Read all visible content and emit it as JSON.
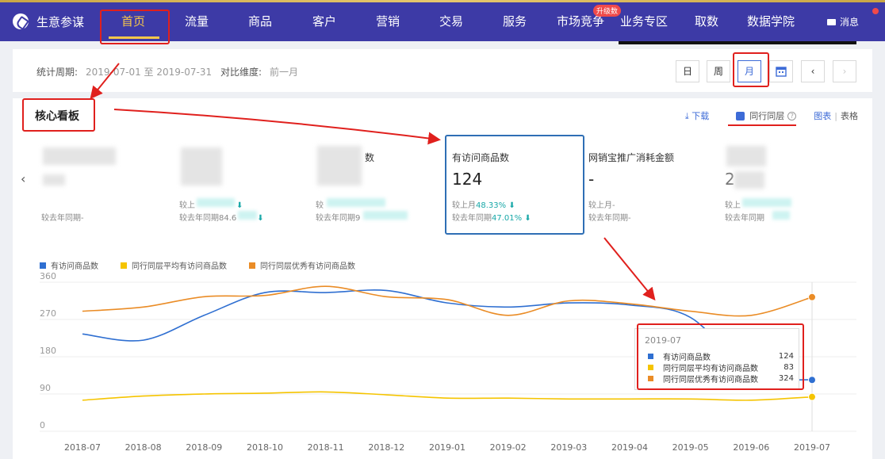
{
  "nav": {
    "brand": "生意参谋",
    "items": [
      "首页",
      "流量",
      "商品",
      "客户",
      "营销",
      "交易",
      "服务",
      "市场竞争",
      "业务专区",
      "取数",
      "数据学院"
    ],
    "active_index": 0,
    "badge": "升级数",
    "message": "消息"
  },
  "period": {
    "range_label": "统计周期:",
    "range_value": "2019-07-01 至 2019-07-31",
    "compare_label": "对比维度:",
    "compare_value": "前一月",
    "buttons": [
      "日",
      "周",
      "月"
    ],
    "active": "月",
    "calendar_icon": "calendar-icon",
    "prev_icon": "chevron-left-icon",
    "next_icon": "chevron-right-icon"
  },
  "board": {
    "title": "核心看板",
    "download": "下载",
    "peer_toggle": "同行同层",
    "peer_checked": true,
    "view_chart": "图表",
    "view_table": "表格"
  },
  "kpis": [
    {
      "name": "",
      "value": "",
      "mom": "",
      "yoy": "较去年同期-"
    },
    {
      "name": "",
      "value": "",
      "mom": "较上",
      "yoy": "较去年同期84.6"
    },
    {
      "name": "数",
      "value": "",
      "mom": "较",
      "yoy": "较去年同期9"
    },
    {
      "name": "有访问商品数",
      "value": "124",
      "mom": "较上月",
      "mom_pct": "48.33%",
      "yoy": "较去年同期",
      "yoy_pct": "47.01%"
    },
    {
      "name": "网销宝推广消耗金额",
      "value": "-",
      "mom": "较上月-",
      "yoy": "较去年同期-"
    },
    {
      "name": "",
      "value": "2",
      "mom": "较上",
      "yoy": "较去年同期"
    }
  ],
  "legend": [
    "有访问商品数",
    "同行同层平均有访问商品数",
    "同行同层优秀有访问商品数"
  ],
  "colors": {
    "blue": "#2f6fd1",
    "yellow": "#f5c400",
    "orange": "#ea8c26",
    "brand": "#3d3aa6",
    "accent": "#3d6bd7",
    "teal": "#19a8a8",
    "annotation": "#e0201d"
  },
  "chart_data": {
    "type": "line",
    "categories": [
      "2018-07",
      "2018-08",
      "2018-09",
      "2018-10",
      "2018-11",
      "2018-12",
      "2019-01",
      "2019-02",
      "2019-03",
      "2019-04",
      "2019-05",
      "2019-06",
      "2019-07"
    ],
    "series": [
      {
        "name": "有访问商品数",
        "color": "#2f6fd1",
        "values": [
          235,
          220,
          280,
          335,
          335,
          340,
          310,
          300,
          310,
          305,
          275,
          140,
          124
        ]
      },
      {
        "name": "同行同层平均有访问商品数",
        "color": "#f5c400",
        "values": [
          75,
          85,
          90,
          92,
          95,
          88,
          80,
          80,
          78,
          78,
          78,
          75,
          83
        ]
      },
      {
        "name": "同行同层优秀有访问商品数",
        "color": "#ea8c26",
        "values": [
          290,
          300,
          325,
          328,
          350,
          325,
          318,
          280,
          315,
          308,
          290,
          280,
          324
        ]
      }
    ],
    "ylim": [
      0,
      360
    ],
    "yticks": [
      0,
      90,
      180,
      270,
      360
    ],
    "grid": true,
    "tooltip": {
      "date": "2019-07",
      "rows": [
        {
          "name": "有访问商品数",
          "value": "124"
        },
        {
          "name": "同行同层平均有访问商品数",
          "value": "83"
        },
        {
          "name": "同行同层优秀有访问商品数",
          "value": "324"
        }
      ]
    }
  }
}
